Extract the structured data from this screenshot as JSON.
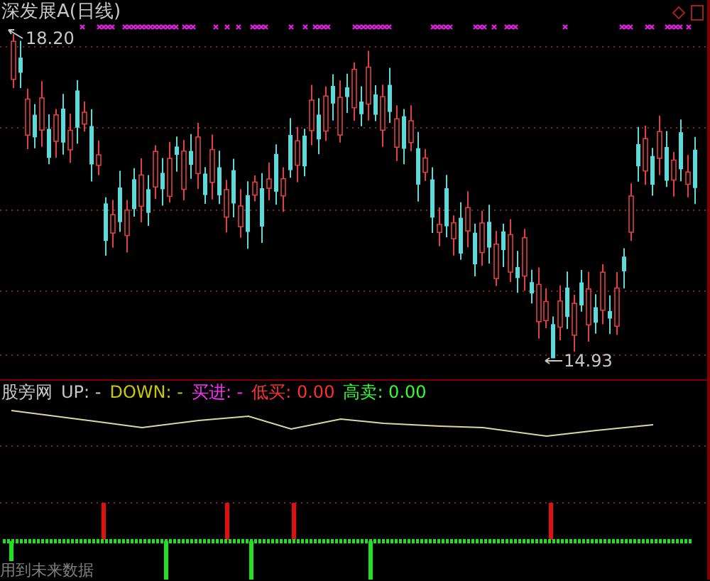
{
  "chart_title": "深发展A(日线)",
  "price_labels": [
    {
      "kind": "high",
      "text": "18.20"
    },
    {
      "kind": "low",
      "text": "14.93"
    }
  ],
  "indicator": {
    "name": "股旁网",
    "items": [
      {
        "label": "UP:",
        "value": "-",
        "color": "#c8c8c8"
      },
      {
        "label": "DOWN:",
        "value": "-",
        "color": "#c8c800"
      },
      {
        "label": "买进:",
        "value": "-",
        "color": "#ff30ff"
      },
      {
        "label": "低买:",
        "value": "0.00",
        "color": "#ff3030"
      },
      {
        "label": "高卖:",
        "value": "0.00",
        "color": "#30ff30"
      }
    ]
  },
  "footer_note": "用到未来数据"
}
